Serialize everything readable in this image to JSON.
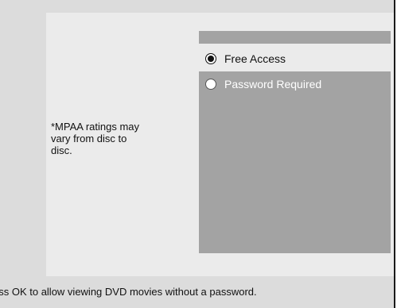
{
  "options": [
    {
      "label": "Free Access",
      "selected": true
    },
    {
      "label": "Password Required",
      "selected": false
    }
  ],
  "note": "*MPAA ratings may\nvary from disc to\ndisc.",
  "status": {
    "text": "Press OK to allow viewing DVD movies without a password."
  },
  "colors": {
    "frame": "#dcdcdc",
    "panel": "#ebebeb",
    "option_box": "#a3a3a3",
    "text": "#111111",
    "inactive_text": "#ffffff"
  }
}
